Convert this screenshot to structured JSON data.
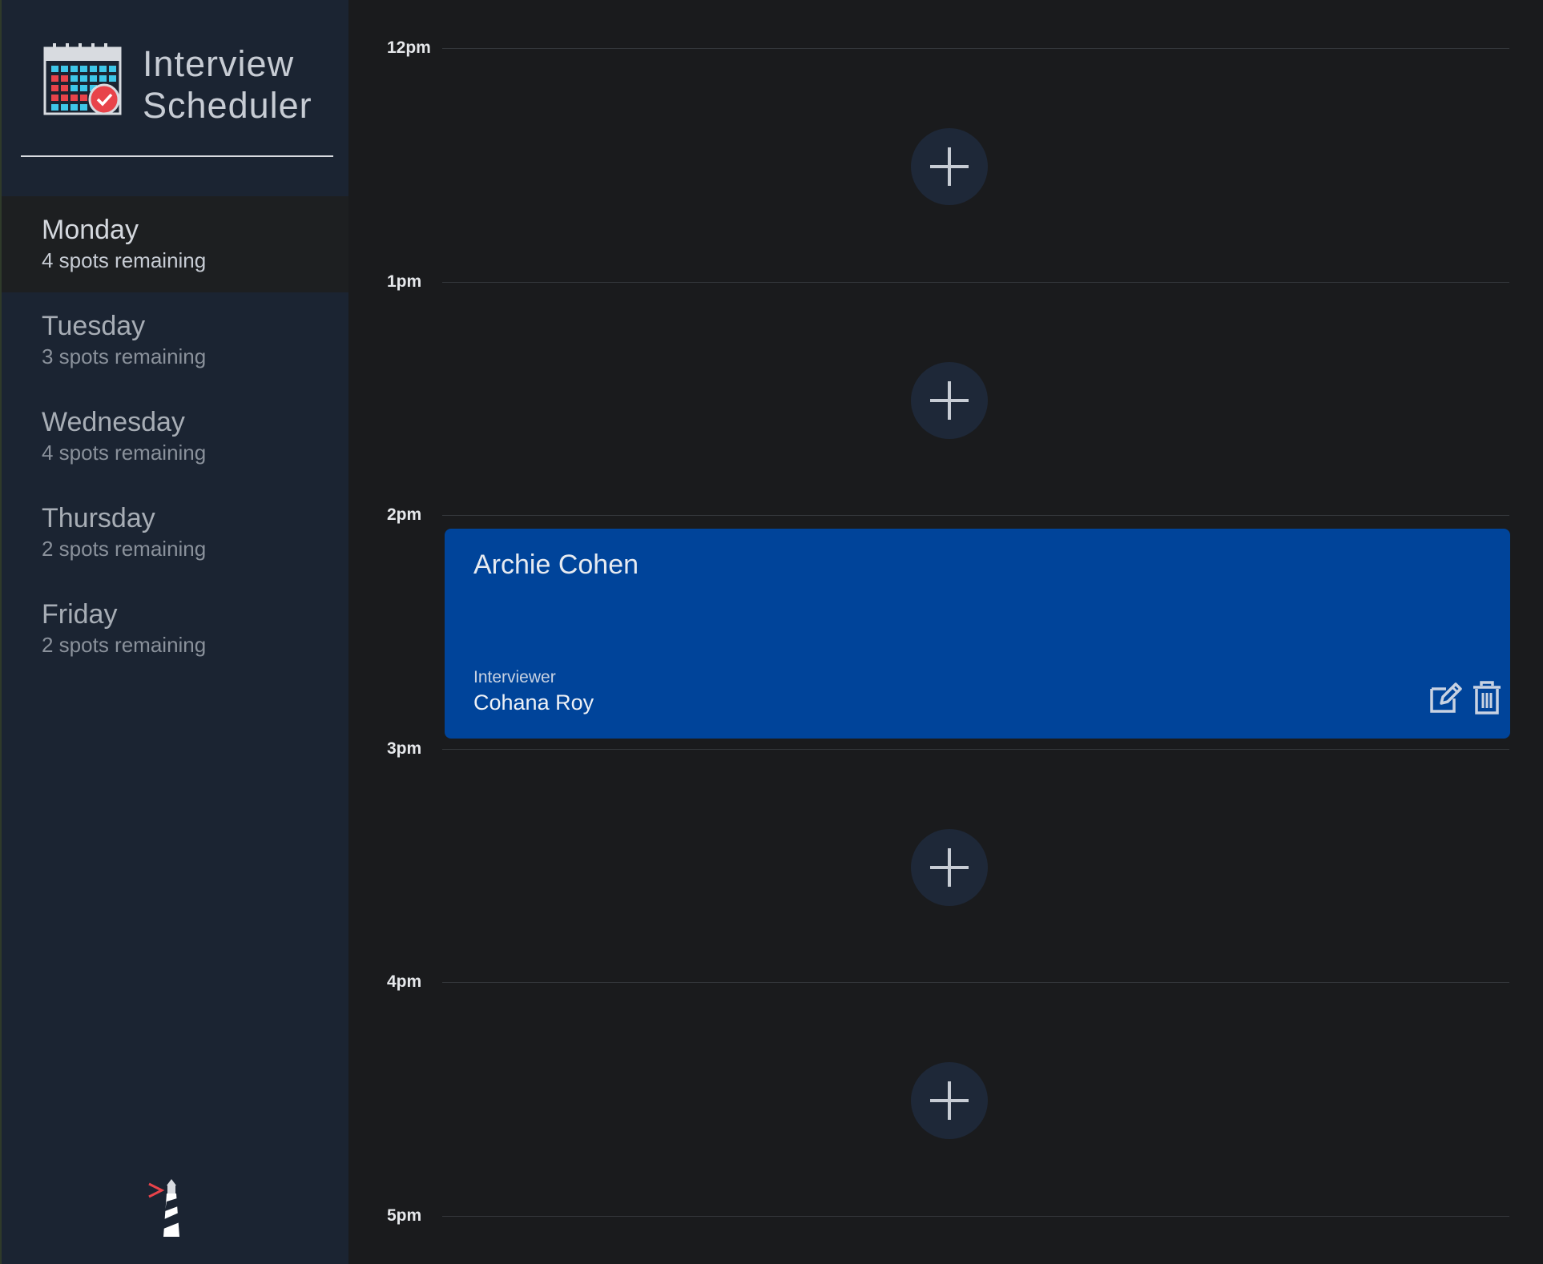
{
  "brand": {
    "line1": "Interview",
    "line2": "Scheduler"
  },
  "days": [
    {
      "name": "Monday",
      "spots": "4 spots remaining",
      "selected": true
    },
    {
      "name": "Tuesday",
      "spots": "3 spots remaining",
      "selected": false
    },
    {
      "name": "Wednesday",
      "spots": "4 spots remaining",
      "selected": false
    },
    {
      "name": "Thursday",
      "spots": "2 spots remaining",
      "selected": false
    },
    {
      "name": "Friday",
      "spots": "2 spots remaining",
      "selected": false
    }
  ],
  "schedule": {
    "times": [
      "12pm",
      "1pm",
      "2pm",
      "3pm",
      "4pm",
      "5pm"
    ],
    "appointment": {
      "student": "Archie Cohen",
      "interviewer_label": "Interviewer",
      "interviewer": "Cohana Roy"
    }
  },
  "icons": {
    "add": "plus-icon",
    "edit": "edit-icon",
    "delete": "trash-icon",
    "logo": "calendar-icon",
    "footer": "lighthouse-icon"
  },
  "colors": {
    "sidebar": "#1b2432",
    "background": "#1a1b1d",
    "appointment": "#00449a",
    "add_button": "#1e2838"
  }
}
